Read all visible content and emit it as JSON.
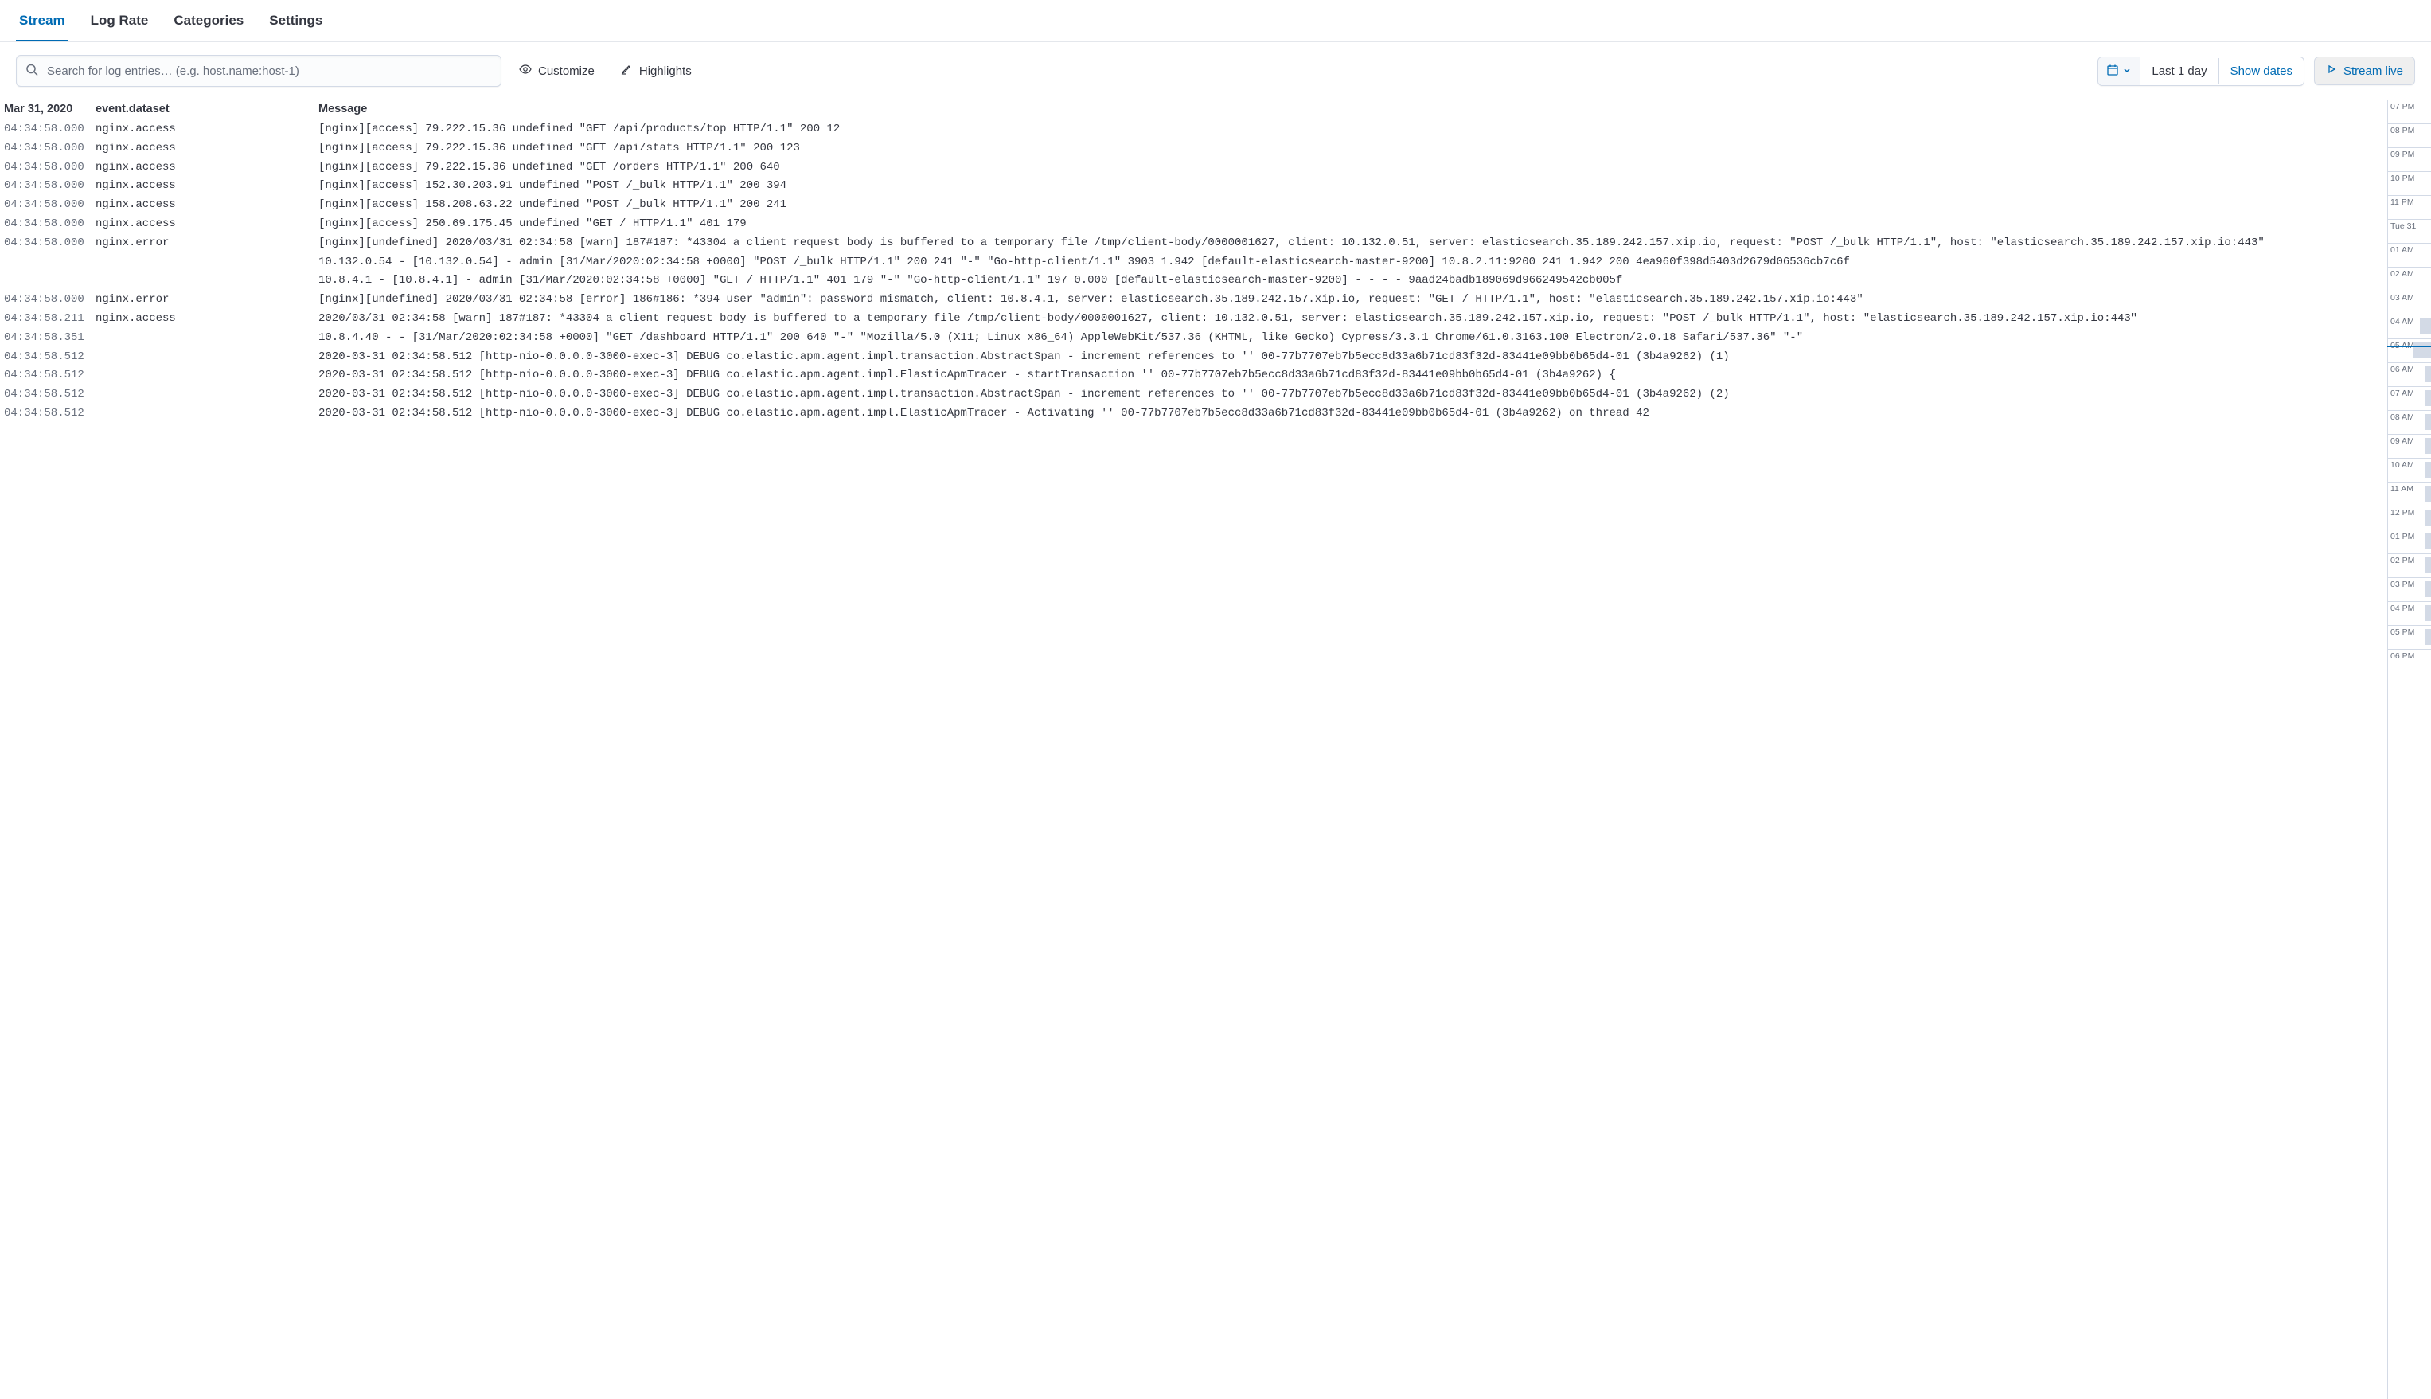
{
  "tabs": {
    "items": [
      "Stream",
      "Log Rate",
      "Categories",
      "Settings"
    ],
    "active": 0
  },
  "toolbar": {
    "search_placeholder": "Search for log entries… (e.g. host.name:host-1)",
    "customize_label": "Customize",
    "highlights_label": "Highlights",
    "date_label": "Last 1 day",
    "show_dates_label": "Show dates",
    "stream_live_label": "Stream live"
  },
  "headers": {
    "date": "Mar 31, 2020",
    "dataset": "event.dataset",
    "message": "Message"
  },
  "logs": [
    {
      "time": "04:34:58.000",
      "dataset": "nginx.access",
      "msg": "[nginx][access] 79.222.15.36 undefined \"GET /api/products/top HTTP/1.1\" 200 12"
    },
    {
      "time": "04:34:58.000",
      "dataset": "nginx.access",
      "msg": "[nginx][access] 79.222.15.36 undefined \"GET /api/stats HTTP/1.1\" 200 123"
    },
    {
      "time": "04:34:58.000",
      "dataset": "nginx.access",
      "msg": "[nginx][access] 79.222.15.36 undefined \"GET /orders HTTP/1.1\" 200 640"
    },
    {
      "time": "04:34:58.000",
      "dataset": "nginx.access",
      "msg": "[nginx][access] 152.30.203.91 undefined \"POST /_bulk HTTP/1.1\" 200 394"
    },
    {
      "time": "04:34:58.000",
      "dataset": "nginx.access",
      "msg": "[nginx][access] 158.208.63.22 undefined \"POST /_bulk HTTP/1.1\" 200 241"
    },
    {
      "time": "04:34:58.000",
      "dataset": "nginx.access",
      "msg": "[nginx][access] 250.69.175.45 undefined \"GET / HTTP/1.1\" 401 179"
    },
    {
      "time": "04:34:58.000",
      "dataset": "nginx.error",
      "msg": "[nginx][undefined] 2020/03/31 02:34:58 [warn] 187#187: *43304 a client request body is buffered to a temporary file /tmp/client-body/0000001627, client: 10.132.0.51, server: elasticsearch.35.189.242.157.xip.io, request: \"POST /_bulk HTTP/1.1\", host: \"elasticsearch.35.189.242.157.xip.io:443\"\n10.132.0.54 - [10.132.0.54] - admin [31/Mar/2020:02:34:58 +0000] \"POST /_bulk HTTP/1.1\" 200 241 \"-\" \"Go-http-client/1.1\" 3903 1.942 [default-elasticsearch-master-9200] 10.8.2.11:9200 241 1.942 200 4ea960f398d5403d2679d06536cb7c6f\n10.8.4.1 - [10.8.4.1] - admin [31/Mar/2020:02:34:58 +0000] \"GET / HTTP/1.1\" 401 179 \"-\" \"Go-http-client/1.1\" 197 0.000 [default-elasticsearch-master-9200] - - - - 9aad24badb189069d966249542cb005f"
    },
    {
      "time": "04:34:58.000",
      "dataset": "nginx.error",
      "msg": "[nginx][undefined] 2020/03/31 02:34:58 [error] 186#186: *394 user \"admin\": password mismatch, client: 10.8.4.1, server: elasticsearch.35.189.242.157.xip.io, request: \"GET / HTTP/1.1\", host: \"elasticsearch.35.189.242.157.xip.io:443\""
    },
    {
      "time": "04:34:58.211",
      "dataset": "nginx.access",
      "msg": "2020/03/31 02:34:58 [warn] 187#187: *43304 a client request body is buffered to a temporary file /tmp/client-body/0000001627, client: 10.132.0.51, server: elasticsearch.35.189.242.157.xip.io, request: \"POST /_bulk HTTP/1.1\", host: \"elasticsearch.35.189.242.157.xip.io:443\""
    },
    {
      "time": "04:34:58.351",
      "dataset": "",
      "msg": "10.8.4.40 - - [31/Mar/2020:02:34:58 +0000] \"GET /dashboard HTTP/1.1\" 200 640 \"-\" \"Mozilla/5.0 (X11; Linux x86_64) AppleWebKit/537.36 (KHTML, like Gecko) Cypress/3.3.1 Chrome/61.0.3163.100 Electron/2.0.18 Safari/537.36\" \"-\""
    },
    {
      "time": "04:34:58.512",
      "dataset": "",
      "msg": "2020-03-31 02:34:58.512 [http-nio-0.0.0.0-3000-exec-3] DEBUG co.elastic.apm.agent.impl.transaction.AbstractSpan - increment references to '' 00-77b7707eb7b5ecc8d33a6b71cd83f32d-83441e09bb0b65d4-01 (3b4a9262) (1)"
    },
    {
      "time": "04:34:58.512",
      "dataset": "",
      "msg": "2020-03-31 02:34:58.512 [http-nio-0.0.0.0-3000-exec-3] DEBUG co.elastic.apm.agent.impl.ElasticApmTracer - startTransaction '' 00-77b7707eb7b5ecc8d33a6b71cd83f32d-83441e09bb0b65d4-01 (3b4a9262) {"
    },
    {
      "time": "04:34:58.512",
      "dataset": "",
      "msg": "2020-03-31 02:34:58.512 [http-nio-0.0.0.0-3000-exec-3] DEBUG co.elastic.apm.agent.impl.transaction.AbstractSpan - increment references to '' 00-77b7707eb7b5ecc8d33a6b71cd83f32d-83441e09bb0b65d4-01 (3b4a9262) (2)"
    },
    {
      "time": "04:34:58.512",
      "dataset": "",
      "msg": "2020-03-31 02:34:58.512 [http-nio-0.0.0.0-3000-exec-3] DEBUG co.elastic.apm.agent.impl.ElasticApmTracer - Activating '' 00-77b7707eb7b5ecc8d33a6b71cd83f32d-83441e09bb0b65d4-01 (3b4a9262) on thread 42"
    }
  ],
  "timeline": {
    "ticks": [
      {
        "label": "07 PM",
        "activity": ""
      },
      {
        "label": "08 PM",
        "activity": ""
      },
      {
        "label": "09 PM",
        "activity": ""
      },
      {
        "label": "10 PM",
        "activity": ""
      },
      {
        "label": "11 PM",
        "activity": ""
      },
      {
        "label": "Tue 31",
        "activity": ""
      },
      {
        "label": "01 AM",
        "activity": ""
      },
      {
        "label": "02 AM",
        "activity": ""
      },
      {
        "label": "03 AM",
        "activity": ""
      },
      {
        "label": "04 AM",
        "activity": "has-activity-med"
      },
      {
        "label": "05 AM",
        "activity": "has-activity-lg"
      },
      {
        "label": "06 AM",
        "activity": "has-activity"
      },
      {
        "label": "07 AM",
        "activity": "has-activity"
      },
      {
        "label": "08 AM",
        "activity": "has-activity"
      },
      {
        "label": "09 AM",
        "activity": "has-activity"
      },
      {
        "label": "10 AM",
        "activity": "has-activity"
      },
      {
        "label": "11 AM",
        "activity": "has-activity"
      },
      {
        "label": "12 PM",
        "activity": "has-activity"
      },
      {
        "label": "01 PM",
        "activity": "has-activity"
      },
      {
        "label": "02 PM",
        "activity": "has-activity"
      },
      {
        "label": "03 PM",
        "activity": "has-activity"
      },
      {
        "label": "04 PM",
        "activity": "has-activity"
      },
      {
        "label": "05 PM",
        "activity": "has-activity"
      },
      {
        "label": "06 PM",
        "activity": ""
      }
    ]
  }
}
